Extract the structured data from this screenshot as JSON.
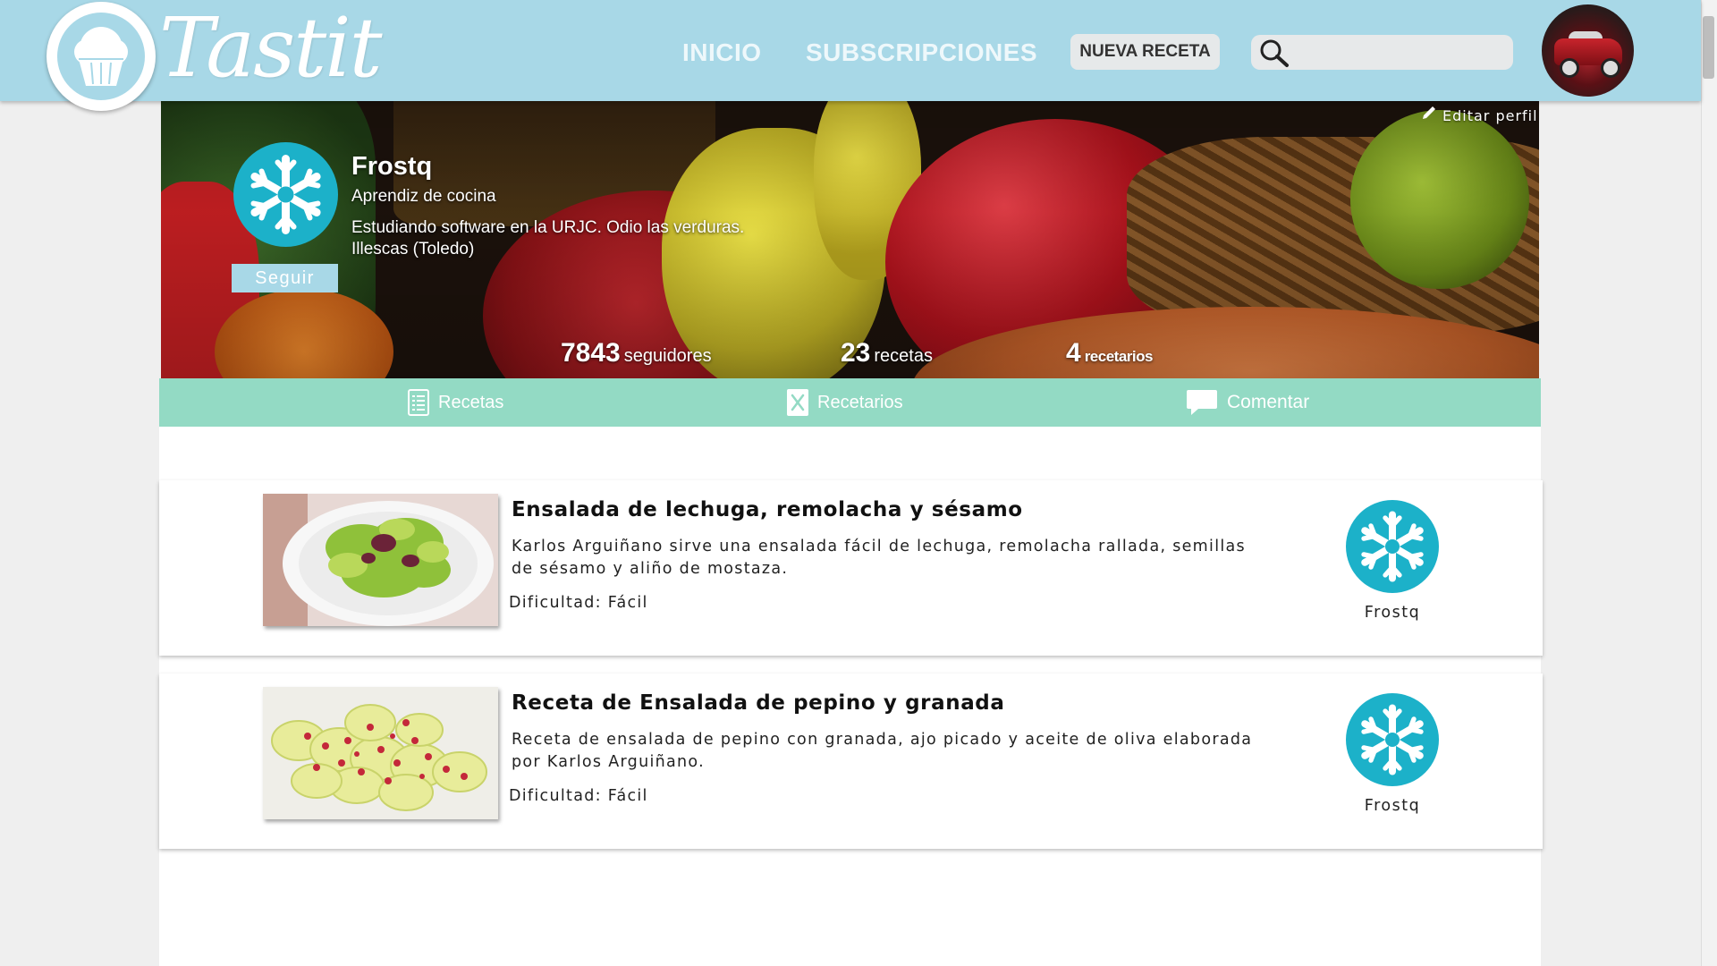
{
  "header": {
    "logo_text": "Tastit",
    "nav": [
      "INICIO",
      "SUBSCRIPCIONES"
    ],
    "new_recipe_label": "NUEVA RECETA",
    "search_placeholder": ""
  },
  "profile": {
    "edit_label": "Editar perfil",
    "name": "Frostq",
    "rank": "Aprendiz de cocina",
    "bio": "Estudiando software en la URJC. Odio las verduras.",
    "location": "Illescas (Toledo)",
    "follow_label": "Seguir",
    "stats": [
      {
        "value": "7843",
        "label": "seguidores"
      },
      {
        "value": "23",
        "label": "recetas"
      },
      {
        "value": "4",
        "label": "recetarios"
      }
    ]
  },
  "tabs": [
    "Recetas",
    "Recetarios",
    "Comentar"
  ],
  "recipes": [
    {
      "title": "Ensalada de lechuga, remolacha y sésamo",
      "description": "Karlos Arguiñano sirve una ensalada fácil de lechuga, remolacha rallada, semillas de sésamo y aliño de mostaza.",
      "difficulty": "Dificultad: Fácil",
      "author": "Frostq"
    },
    {
      "title": "Receta de Ensalada de pepino y granada",
      "description": "Receta de ensalada de pepino con granada, ajo picado y aceite de oliva elaborada por Karlos Arguiñano.",
      "difficulty": "Dificultad: Fácil",
      "author": "Frostq"
    }
  ],
  "colors": {
    "header": "#a8d8e7",
    "tabbar": "#93dac4",
    "avatar_bg": "#1cb1c9"
  },
  "icons": [
    "cupcake-icon",
    "search-icon",
    "pencil-icon",
    "snowflake-icon",
    "list-icon",
    "cookbook-icon",
    "comment-icon"
  ]
}
